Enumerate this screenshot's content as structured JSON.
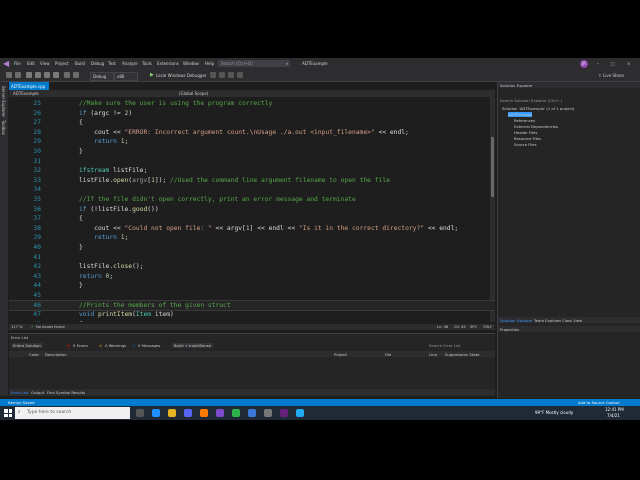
{
  "menu": {
    "items": [
      "File",
      "Edit",
      "View",
      "Project",
      "Build",
      "Debug",
      "Test",
      "Analyze",
      "Tools",
      "Extensions",
      "Window",
      "Help"
    ],
    "search_placeholder": "Search (Ctrl+Q)",
    "solution_name": "ADTExample",
    "avatar_initials": "JR",
    "live_share": "Live Share"
  },
  "toolbar": {
    "config": "Debug",
    "platform": "x86",
    "run_label": "Local Windows Debugger"
  },
  "left_strip": [
    "Server Explorer",
    "Toolbox"
  ],
  "doc_tab": "ADTExample.cpp",
  "navbar": {
    "project": "ADTExample",
    "scope": "(Global Scope)"
  },
  "code_lines": [
    {
      "n": "25",
      "segs": [
        [
          "cm",
          "//Make sure the user is using the program correctly"
        ]
      ]
    },
    {
      "n": "26",
      "segs": [
        [
          "kw",
          "if"
        ],
        [
          "df",
          " (argc != "
        ],
        [
          "num",
          "2"
        ],
        [
          "df",
          ")"
        ]
      ]
    },
    {
      "n": "27",
      "segs": [
        [
          "df",
          "{"
        ]
      ]
    },
    {
      "n": "28",
      "segs": [
        [
          "df",
          "    cout << "
        ],
        [
          "st",
          "\"ERROR: Incorrect argument count.\\nUsage ./a.out <input_filename>\""
        ],
        [
          "df",
          " << endl;"
        ]
      ]
    },
    {
      "n": "29",
      "segs": [
        [
          "kw",
          "    return"
        ],
        [
          "df",
          " "
        ],
        [
          "num",
          "1"
        ],
        [
          "df",
          ";"
        ]
      ]
    },
    {
      "n": "30",
      "segs": [
        [
          "df",
          "}"
        ]
      ]
    },
    {
      "n": "31",
      "segs": [
        [
          "df",
          ""
        ]
      ]
    },
    {
      "n": "32",
      "segs": [
        [
          "ty",
          "ifstream"
        ],
        [
          "df",
          " listFile;"
        ]
      ]
    },
    {
      "n": "33",
      "segs": [
        [
          "df",
          "listFile."
        ],
        [
          "fn",
          "open"
        ],
        [
          "df",
          "("
        ],
        [
          "pm",
          "argv"
        ],
        [
          "df",
          "["
        ],
        [
          "num",
          "1"
        ],
        [
          "df",
          "]); "
        ],
        [
          "cm",
          "//Used the command line argument filename to open the file"
        ]
      ]
    },
    {
      "n": "34",
      "segs": [
        [
          "df",
          ""
        ]
      ]
    },
    {
      "n": "35",
      "segs": [
        [
          "cm",
          "//If the file didn't open correctly, print an error message and terminate"
        ]
      ]
    },
    {
      "n": "36",
      "segs": [
        [
          "kw",
          "if"
        ],
        [
          "df",
          " (!listFile."
        ],
        [
          "fn",
          "good"
        ],
        [
          "df",
          "())"
        ]
      ]
    },
    {
      "n": "37",
      "segs": [
        [
          "df",
          "{"
        ]
      ]
    },
    {
      "n": "38",
      "segs": [
        [
          "df",
          "    cout << "
        ],
        [
          "st",
          "\"Could not open file: \""
        ],
        [
          "df",
          " << argv["
        ],
        [
          "num",
          "1"
        ],
        [
          "df",
          "] << endl << "
        ],
        [
          "st",
          "\"Is it in the correct directory?\""
        ],
        [
          "df",
          " << endl;"
        ]
      ]
    },
    {
      "n": "39",
      "segs": [
        [
          "kw",
          "    return"
        ],
        [
          "df",
          " "
        ],
        [
          "num",
          "1"
        ],
        [
          "df",
          ";"
        ]
      ]
    },
    {
      "n": "40",
      "segs": [
        [
          "df",
          "}"
        ]
      ]
    },
    {
      "n": "41",
      "segs": [
        [
          "df",
          ""
        ]
      ]
    },
    {
      "n": "42",
      "segs": [
        [
          "df",
          "listFile."
        ],
        [
          "fn",
          "close"
        ],
        [
          "df",
          "();"
        ]
      ]
    },
    {
      "n": "43",
      "segs": [
        [
          "kw",
          "return"
        ],
        [
          "df",
          " "
        ],
        [
          "num",
          "0"
        ],
        [
          "df",
          ";"
        ]
      ]
    },
    {
      "n": "44",
      "segs": [
        [
          "df",
          "}"
        ]
      ]
    },
    {
      "n": "45",
      "segs": [
        [
          "df",
          ""
        ]
      ]
    },
    {
      "n": "46",
      "segs": [
        [
          "cm",
          "//Prints the members of the given struct"
        ]
      ]
    },
    {
      "n": "47",
      "segs": [
        [
          "kw",
          "void"
        ],
        [
          "df",
          " "
        ],
        [
          "fn",
          "printItem"
        ],
        [
          "df",
          "("
        ],
        [
          "ty",
          "Item"
        ],
        [
          "df",
          " item)"
        ]
      ]
    },
    {
      "n": "48",
      "segs": [
        [
          "df",
          "{"
        ]
      ]
    }
  ],
  "editor_status": {
    "zoom": "117 %",
    "issues": "No issues found",
    "position": "Ln: 46",
    "col": "Ch: 43",
    "mode": "SPC",
    "eol": "CRLF"
  },
  "error_list": {
    "title": "Error List",
    "scope": "Entire Solution",
    "errors": "0 Errors",
    "warnings": "0 Warnings",
    "messages": "0 Messages",
    "filter": "Build + IntelliSense",
    "search": "Search Error List",
    "columns": [
      "Code",
      "Description",
      "Project",
      "File",
      "Line",
      "Suppression State"
    ]
  },
  "bottom_tabs": [
    "Error List",
    "Output",
    "Find Symbol Results"
  ],
  "status_bar": {
    "left": "Item(s) Saved",
    "right": "Add to Source Control"
  },
  "solution_explorer": {
    "title": "Solution Explorer",
    "search": "Search Solution Explorer (Ctrl+;)",
    "items": [
      {
        "label": "Solution 'ADTExample' (1 of 1 project)",
        "indent": 0,
        "sel": false
      },
      {
        "label": "ADTExample",
        "indent": 1,
        "sel": true
      },
      {
        "label": "References",
        "indent": 2,
        "sel": false
      },
      {
        "label": "External Dependencies",
        "indent": 2,
        "sel": false
      },
      {
        "label": "Header Files",
        "indent": 2,
        "sel": false
      },
      {
        "label": "Resource Files",
        "indent": 2,
        "sel": false
      },
      {
        "label": "Source Files",
        "indent": 2,
        "sel": false
      }
    ],
    "tabs": [
      "Solution Explorer",
      "Team Explorer",
      "Class View"
    ],
    "properties": "Properties"
  },
  "taskbar": {
    "search_placeholder": "Type here to search",
    "weather": "99°F  Mostly cloudy",
    "time": "12:41 PM",
    "date": "7/4/21"
  }
}
